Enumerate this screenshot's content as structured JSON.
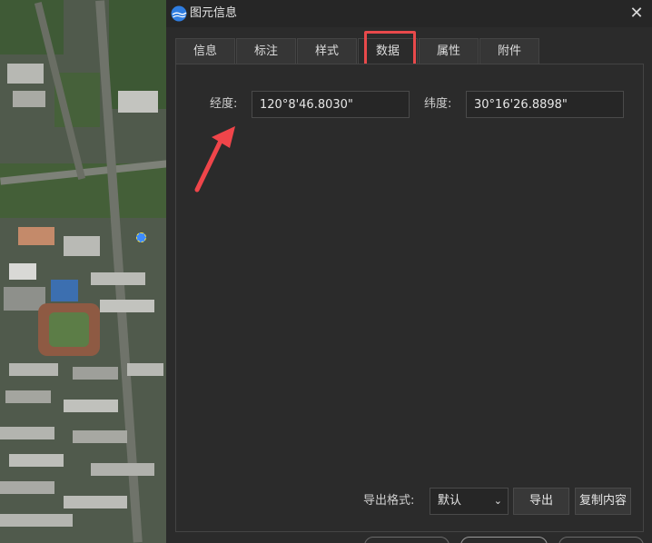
{
  "window": {
    "title": "图元信息",
    "close_glyph": "✕",
    "logo_icon": "app-logo-icon",
    "close_icon": "close-icon"
  },
  "tabs": [
    {
      "label": "信息",
      "active": false
    },
    {
      "label": "标注",
      "active": false
    },
    {
      "label": "样式",
      "active": false
    },
    {
      "label": "数据",
      "active": true
    },
    {
      "label": "属性",
      "active": false
    },
    {
      "label": "附件",
      "active": false
    }
  ],
  "data_panel": {
    "longitude": {
      "label": "经度:",
      "value": "120°8'46.8030\""
    },
    "latitude": {
      "label": "纬度:",
      "value": "30°16'26.8898\""
    }
  },
  "export": {
    "format_label": "导出格式:",
    "format_value": "默认",
    "export_button": "导出",
    "copy_button": "复制内容"
  },
  "colors": {
    "highlight": "#e8494b",
    "marker": "#3d8bff",
    "background": "#2b2b2b"
  }
}
